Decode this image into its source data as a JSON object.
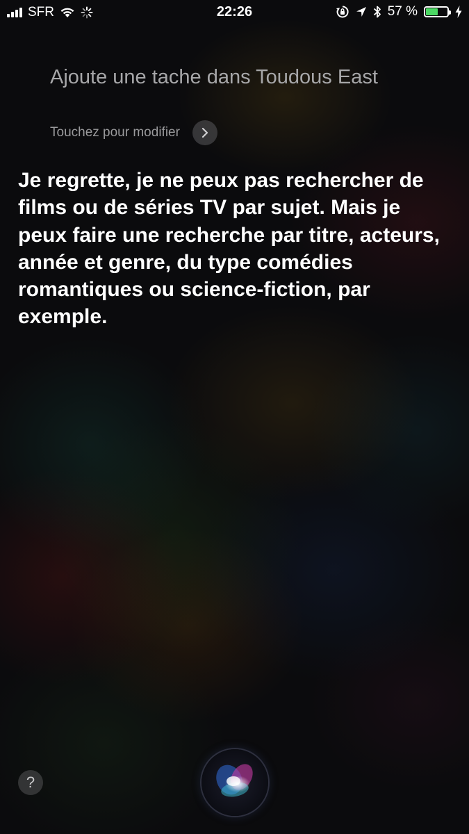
{
  "status_bar": {
    "carrier": "SFR",
    "time": "22:26",
    "battery_percent": "57 %",
    "battery_level": 0.57,
    "icons": [
      "signal-icon",
      "wifi-icon",
      "activity-spinner-icon",
      "rotation-lock-icon",
      "location-icon",
      "bluetooth-icon",
      "battery-icon",
      "charging-bolt-icon"
    ]
  },
  "query": {
    "text": "Ajoute une tache dans Toudous East",
    "edit_hint": "Touchez pour modifier"
  },
  "response": {
    "text": "Je regrette, je ne peux pas rechercher de films ou de séries TV par sujet. Mais je peux faire une recherche par titre, acteurs, année et genre, du type comédies romantiques ou science-fiction, par exemple."
  },
  "bottom": {
    "help_label": "?"
  },
  "colors": {
    "battery_fill": "#4cd964",
    "query_text": "#a7a7a9",
    "response_text": "#ffffff"
  }
}
